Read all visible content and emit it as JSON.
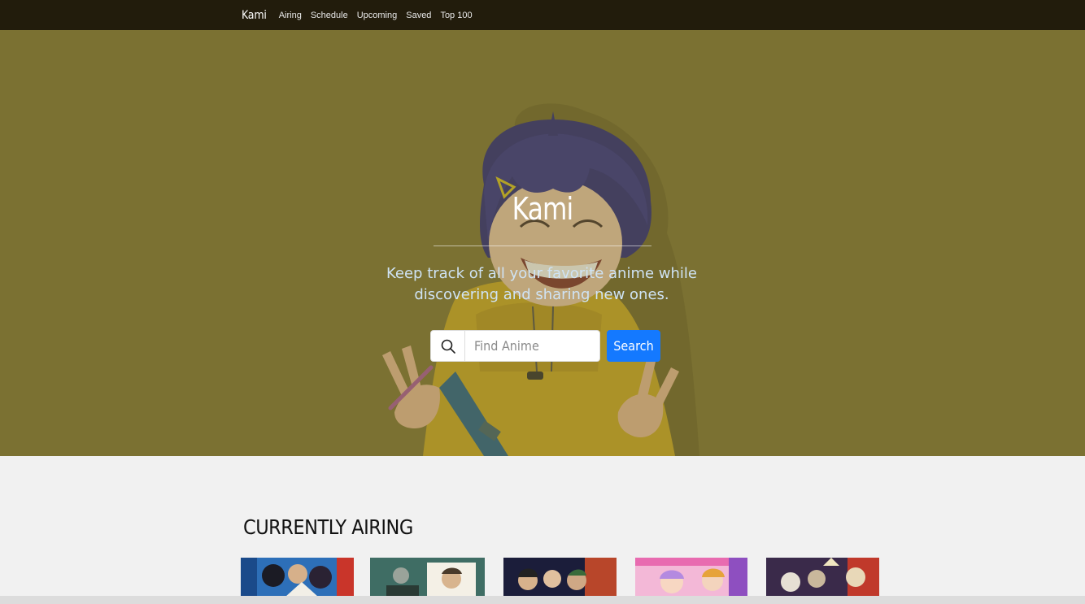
{
  "nav": {
    "brand": "Kami",
    "links": [
      "Airing",
      "Schedule",
      "Upcoming",
      "Saved",
      "Top 100"
    ]
  },
  "hero": {
    "title": "Kami",
    "subtitle": "Keep track of all your favorite anime while discovering and sharing new ones.",
    "background_color": "#7b7232",
    "image": "anime-girl-peace-sign"
  },
  "search": {
    "icon": "search-icon",
    "placeholder": "Find Anime",
    "value": "",
    "button_label": "Search",
    "button_color": "#1479ff"
  },
  "airing": {
    "heading": "CURRENTLY AIRING",
    "cards": [
      {
        "thumbnail": "anime-poster-1"
      },
      {
        "thumbnail": "anime-poster-2"
      },
      {
        "thumbnail": "anime-poster-3"
      },
      {
        "thumbnail": "anime-poster-4"
      },
      {
        "thumbnail": "anime-poster-5"
      }
    ]
  },
  "colors": {
    "navbar": "#221c0c",
    "page_background": "#f1f1f1"
  }
}
